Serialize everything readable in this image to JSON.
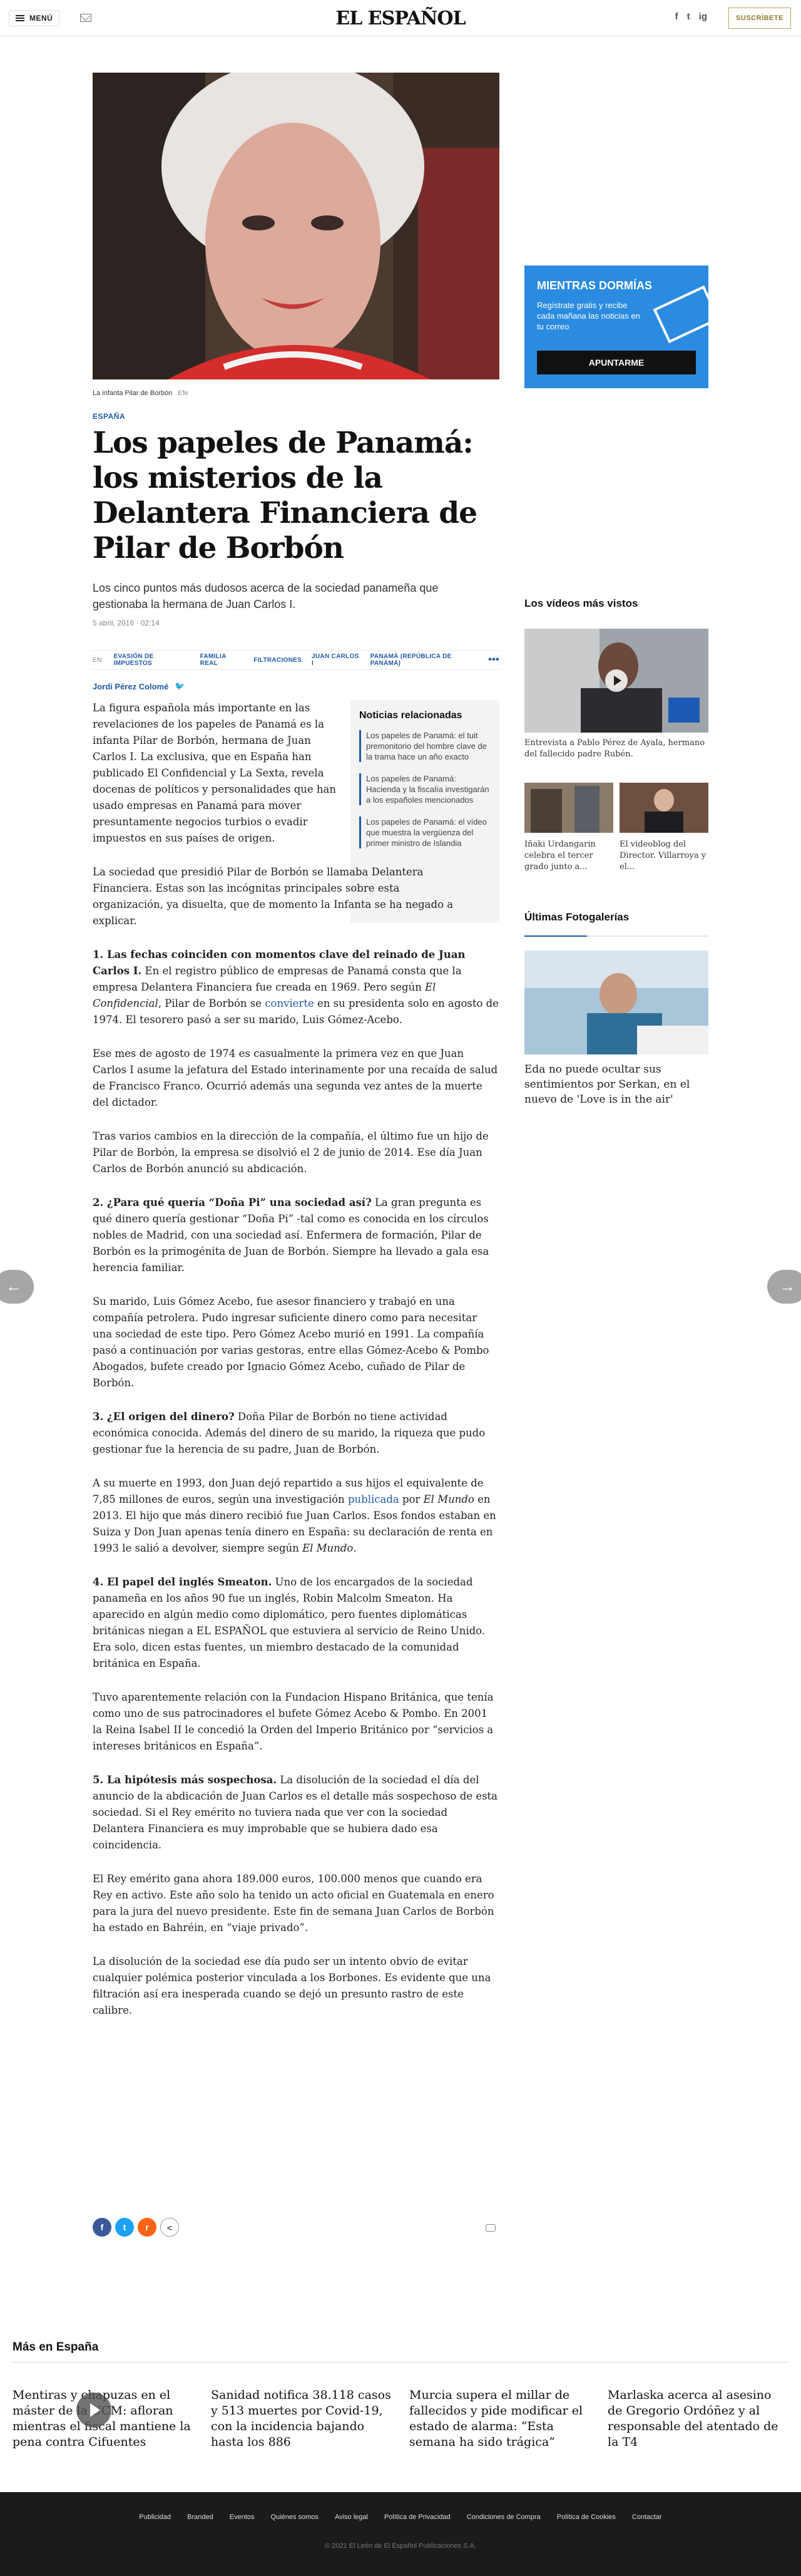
{
  "header": {
    "menu_label": "MENÚ",
    "logo": "EL ESPAÑOL",
    "social": [
      "f",
      "t",
      "ig"
    ],
    "subscribe_label": "SUSCRÍBETE"
  },
  "article": {
    "caption": "La infanta Pilar de Borbón",
    "caption_credit": "Efe",
    "section": "ESPAÑA",
    "headline": "Los papeles de Panamá: los misterios de la Delantera Financiera de Pilar de Borbón",
    "subhead": "Los cinco puntos más dudosos acerca de la sociedad panameña que gestionaba la hermana de Juan Carlos I.",
    "date": "5 abril, 2016 · 02:14",
    "tags_prefix": "EN:",
    "tags": [
      "EVASIÓN DE IMPUESTOS",
      "FAMILIA REAL",
      "FILTRACIONES",
      "JUAN CARLOS I",
      "PANAMÁ (REPÚBLICA DE PANAMÁ)"
    ],
    "tags_more": "•••",
    "author": "Jordi Pérez Colomé",
    "author_twitter": "🐦",
    "p1": "La figura española más importante en las revelaciones de los papeles de Panamá es la infanta Pilar de Borbón, hermana de Juan Carlos I. La exclusiva, que en España han publicado El Confidencial y La Sexta, revela docenas de políticos y personalidades que han usado empresas en Panamá para mover presuntamente negocios turbios o evadir impuestos en sus países de origen.",
    "p2": "La sociedad que presidió Pilar de Borbón se llamaba Delantera Financiera. Estas son las incógnitas principales sobre esta organización, ya disuelta, que de momento la Infanta se ha negado a explicar.",
    "h1": "1. Las fechas coinciden con momentos clave del reinado de Juan Carlos I.",
    "p3a": " En el registro público de empresas de Panamá consta que la empresa Delantera Financiera fue creada en 1969. Pero según ",
    "p3_em": "El Confidencial",
    "p3b": ", Pilar de Borbón se ",
    "p3_link": "convierte",
    "p3c": " en su presidenta solo en agosto de 1974. El tesorero pasó a ser su marido, Luis Gómez-Acebo.",
    "p4": "Ese mes de agosto de 1974 es casualmente la primera vez en que Juan Carlos I asume la jefatura del Estado interinamente por una recaída de salud de Francisco Franco. Ocurrió además una segunda vez antes de la muerte del dictador.",
    "p5": "Tras varios cambios en la dirección de la compañía, el último fue un hijo de Pilar de Borbón, la empresa se disolvió el 2 de junio de 2014. Ese día Juan Carlos de Borbón anunció su abdicación.",
    "h2": "2. ¿Para qué quería “Doña Pi” una sociedad así?",
    "p6": " La gran pregunta es qué dinero quería gestionar “Doña Pi” -tal como es conocida en los círculos nobles de Madrid, con una sociedad así. Enfermera de formación, Pilar de Borbón es la primogénita de Juan de Borbón. Siempre ha llevado a gala esa herencia familiar.",
    "p7": "Su marido, Luis Gómez Acebo, fue asesor financiero y trabajó en una compañía petrolera. Pudo ingresar suficiente dinero como para necesitar una sociedad de este tipo. Pero Gómez Acebo murió en 1991. La compañía pasó a continuación por varias gestoras, entre ellas Gómez-Acebo & Pombo Abogados, bufete creado por Ignacio Gómez Acebo, cuñado de Pilar de Borbón.",
    "h3": "3. ¿El origen del dinero?",
    "p8": " Doña Pilar de Borbón no tiene actividad económica conocida. Además del dinero de su marido, la riqueza que pudo gestionar fue la herencia de su padre, Juan de Borbón.",
    "p9a": "A su muerte en 1993, don Juan dejó repartido a sus hijos el equivalente de 7,85 millones de euros, según una investigación ",
    "p9_link": "publicada",
    "p9b": " por ",
    "p9_em": "El Mundo",
    "p9c": " en 2013. El hijo que más dinero recibió fue Juan Carlos. Esos fondos estaban en Suiza y Don Juan apenas tenía dinero en España: su declaración de renta en 1993 le salió a devolver, siempre según ",
    "p9_em2": "El Mundo",
    "p9d": ".",
    "h4": "4. El papel del inglés Smeaton.",
    "p10": " Uno de los encargados de la sociedad panameña en los años 90 fue un inglés, Robin Malcolm Smeaton. Ha aparecido en algún medio como diplomático, pero fuentes diplomáticas británicas niegan a EL ESPAÑOL que estuviera al servicio de Reino Unido. Era solo, dicen estas fuentes, un miembro destacado de la comunidad británica en España.",
    "p11": "Tuvo aparentemente relación con la Fundacion Hispano Británica, que tenía como uno de sus patrocinadores el bufete Gómez Acebo & Pombo. En 2001 la Reina Isabel II le concedió la Orden del Imperio Británico por “servicios a intereses británicos en España”.",
    "h5": "5. La hipótesis más sospechosa.",
    "p12": " La disolución de la sociedad el día del anuncio de la abdicación de Juan Carlos es el detalle más sospechoso de esta sociedad. Si el Rey emérito no tuviera nada que ver con la sociedad Delantera Financiera es muy improbable que se hubiera dado esa coincidencia.",
    "p13": "El Rey emérito gana ahora 189.000 euros, 100.000 menos que cuando era Rey en activo. Este año solo ha tenido un acto oficial en Guatemala en enero para la jura del nuevo presidente. Este fin de semana Juan Carlos de Borbón ha estado en Bahréin, en “viaje privado”.",
    "p14": "La disolución de la sociedad ese día pudo ser un intento obvio de evitar cualquier polémica posterior vinculada a los Borbones. Es evidente que una filtración así era inesperada cuando se dejó un presunto rastro de este calibre."
  },
  "related": {
    "title": "Noticias relacionadas",
    "items": [
      "Los papeles de Panamá: el tuit premonitorio del hombre clave de la trama hace un año exacto",
      "Los papeles de Panamá: Hacienda y la fiscalía investigarán a los españoles mencionados",
      "Los papeles de Panamá: el vídeo que muestra la vergüenza del primer ministro de Islandia"
    ]
  },
  "newsletter": {
    "title": "MIENTRAS DORMÍAS",
    "text": "Regístrate gratis y recibe cada mañana las noticias en tu correo",
    "button": "APUNTARME"
  },
  "videos": {
    "title": "Los vídeos más vistos",
    "main_caption": "Entrevista a Pablo Pérez de Ayala, hermano del fallecido padre Rubén.",
    "small": [
      "Iñaki Urdangarin celebra el tercer grado junto a...",
      "El videoblog del Director. Villarroya y el..."
    ]
  },
  "gallery": {
    "title": "Últimas Fotogalerías",
    "caption": "Eda no puede ocultar sus sentimientos por Serkan, en el nuevo de 'Love is in the air'"
  },
  "more": {
    "title": "Más en España",
    "items": [
      "Mentiras y chapuzas en el máster de la UCM: afloran mientras el fiscal mantiene la pena contra Cifuentes",
      "Sanidad notifica 38.118 casos y 513 muertes por Covid-19, con la incidencia bajando hasta los 886",
      "Murcia supera el millar de fallecidos y pide modificar el estado de alarma: “Esta semana ha sido trágica”",
      "Marlaska acerca al asesino de Gregorio Ordóñez y al responsable del atentado de la T4"
    ]
  },
  "footer": {
    "links": [
      "Publicidad",
      "Branded",
      "Eventos",
      "Quiénes somos",
      "Aviso legal",
      "Política de Privacidad",
      "Condiciones de Compra",
      "Política de Cookies",
      "Contactar"
    ],
    "copyright": "© 2021 El León de El Español Publicaciones S.A."
  },
  "colors": {
    "accent": "#1f5aa6",
    "newsletter": "#2a8be0",
    "footer": "#1b1b1b",
    "subscribe": "#b9a65a"
  }
}
